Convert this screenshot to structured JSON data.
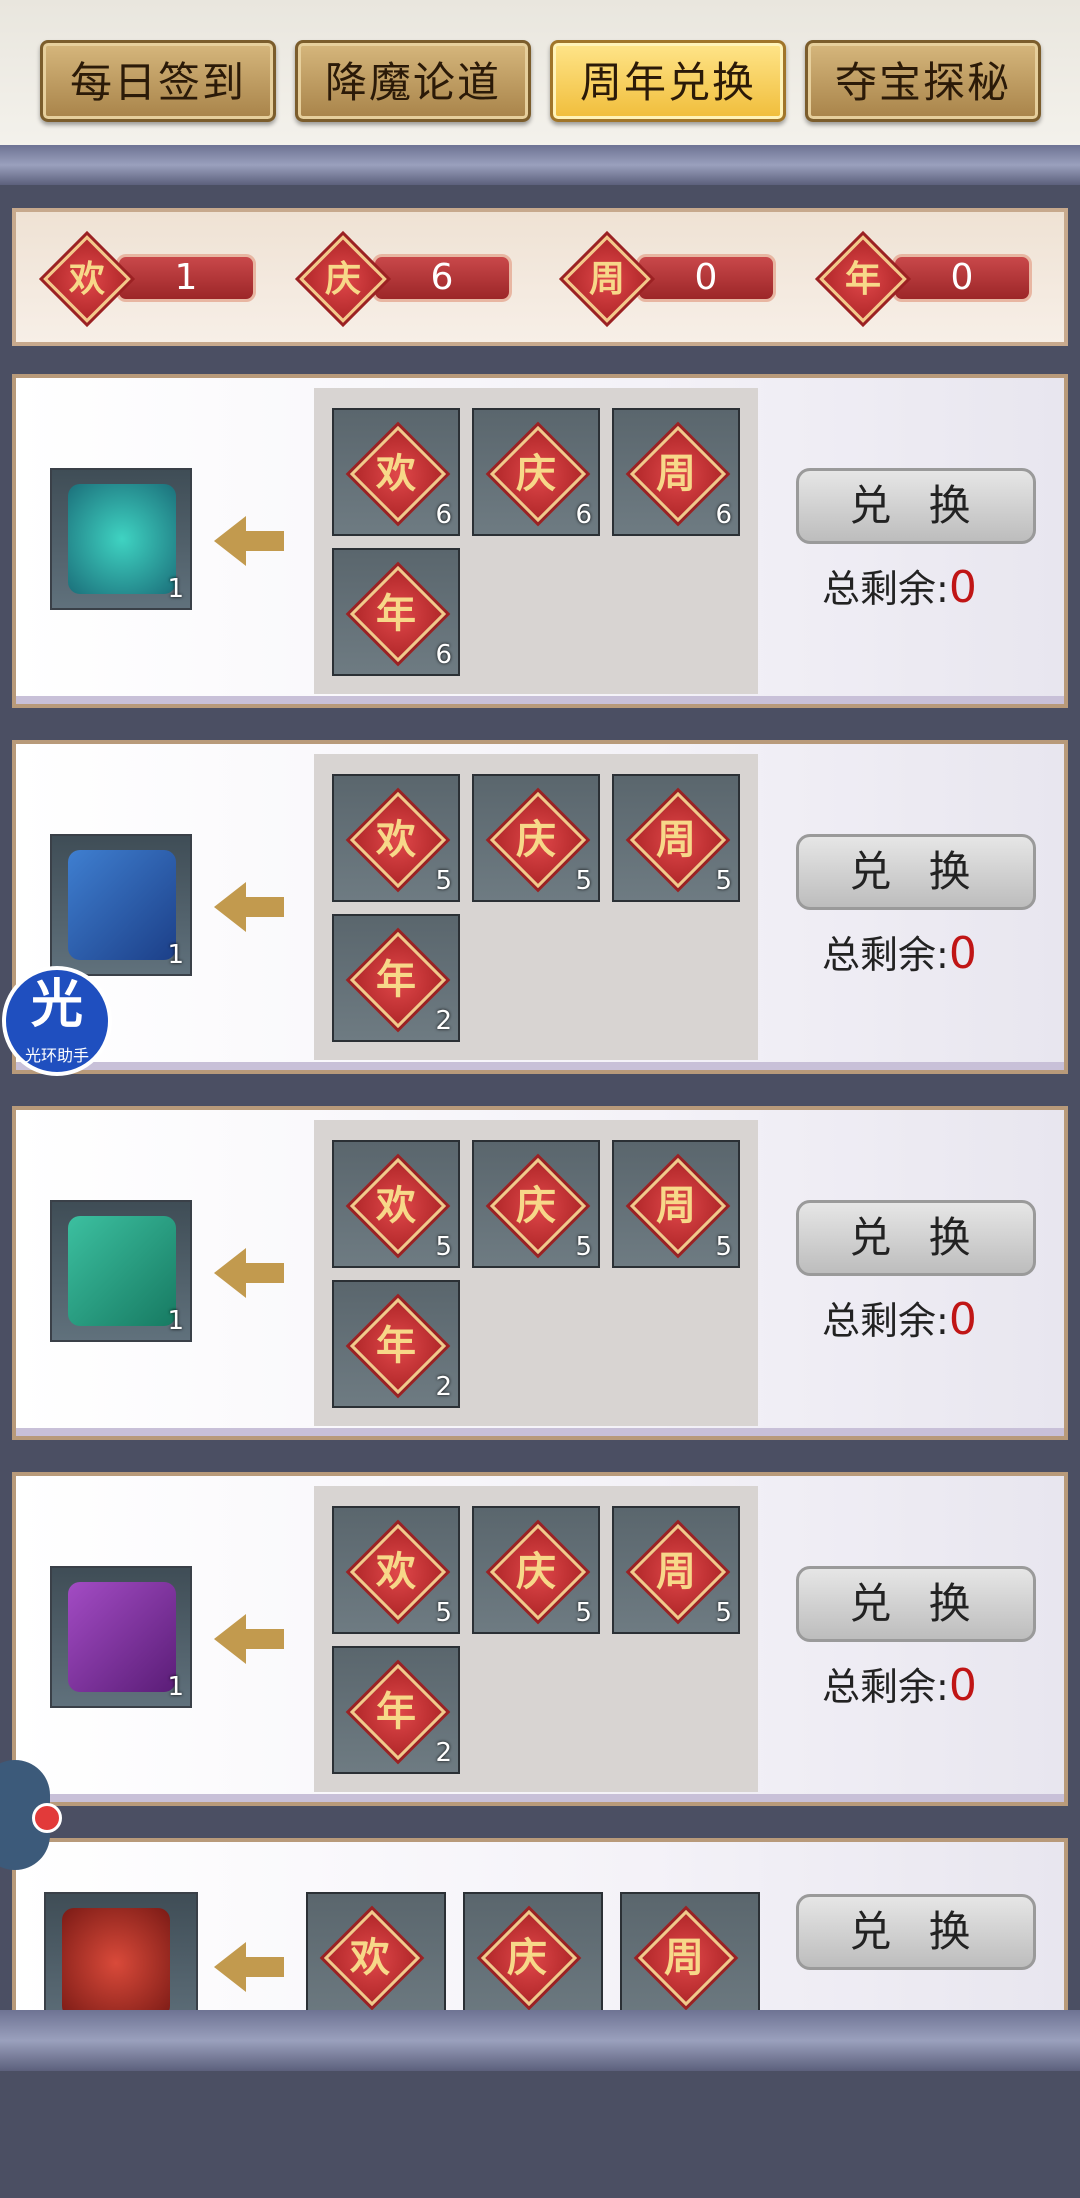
{
  "tabs": [
    {
      "label": "每日签到",
      "active": false
    },
    {
      "label": "降魔论道",
      "active": false
    },
    {
      "label": "周年兑换",
      "active": true
    },
    {
      "label": "夺宝探秘",
      "active": false
    }
  ],
  "currencies": [
    {
      "char": "欢",
      "count": "1"
    },
    {
      "char": "庆",
      "count": "6"
    },
    {
      "char": "周",
      "count": "0"
    },
    {
      "char": "年",
      "count": "0"
    }
  ],
  "exchange_button_label": "兑 换",
  "remaining_label": "总剩余:",
  "cards": [
    {
      "reward_icon": "jade-pouch-icon",
      "reward_qty": "1",
      "costs": [
        {
          "char": "欢",
          "qty": "6"
        },
        {
          "char": "庆",
          "qty": "6"
        },
        {
          "char": "周",
          "qty": "6"
        },
        {
          "char": "年",
          "qty": "6"
        }
      ],
      "remaining": "0"
    },
    {
      "reward_icon": "blue-book-icon",
      "reward_qty": "1",
      "costs": [
        {
          "char": "欢",
          "qty": "5"
        },
        {
          "char": "庆",
          "qty": "5"
        },
        {
          "char": "周",
          "qty": "5"
        },
        {
          "char": "年",
          "qty": "2"
        }
      ],
      "remaining": "0"
    },
    {
      "reward_icon": "green-book-icon",
      "reward_qty": "1",
      "costs": [
        {
          "char": "欢",
          "qty": "5"
        },
        {
          "char": "庆",
          "qty": "5"
        },
        {
          "char": "周",
          "qty": "5"
        },
        {
          "char": "年",
          "qty": "2"
        }
      ],
      "remaining": "0"
    },
    {
      "reward_icon": "purple-book-icon",
      "reward_qty": "1",
      "costs": [
        {
          "char": "欢",
          "qty": "5"
        },
        {
          "char": "庆",
          "qty": "5"
        },
        {
          "char": "周",
          "qty": "5"
        },
        {
          "char": "年",
          "qty": "2"
        }
      ],
      "remaining": "0"
    },
    {
      "reward_icon": "red-emblem-icon",
      "reward_qty": "",
      "costs": [
        {
          "char": "欢",
          "qty": ""
        },
        {
          "char": "庆",
          "qty": ""
        },
        {
          "char": "周",
          "qty": ""
        }
      ],
      "remaining": ""
    }
  ],
  "helper": {
    "big": "光",
    "small": "光环助手"
  },
  "colors": {
    "accent_red": "#b2282a",
    "gold": "#f7d889",
    "tab_active": "#f0bd3a"
  }
}
